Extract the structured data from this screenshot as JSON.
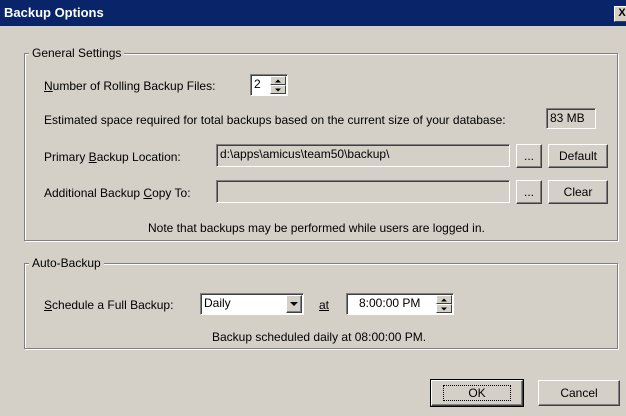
{
  "window": {
    "title": "Backup Options",
    "close_label": "X"
  },
  "general": {
    "legend": "General Settings",
    "rolling": {
      "label_pre": "",
      "label_accel": "N",
      "label_post": "umber of Rolling Backup Files:",
      "value": "2"
    },
    "estimate": {
      "label": "Estimated space required for total backups based on the current size of your database:",
      "value": "83 MB"
    },
    "primary": {
      "label_pre": "Primary ",
      "label_accel": "B",
      "label_post": "ackup Location:",
      "value": "d:\\apps\\amicus\\team50\\backup\\",
      "browse_label": "...",
      "default_label": "Default"
    },
    "additional": {
      "label_pre": "Additional Backup ",
      "label_accel": "C",
      "label_post": "opy To:",
      "value": "",
      "browse_label": "...",
      "clear_label": "Clear"
    },
    "note": "Note that backups may be performed while users are logged in."
  },
  "autobackup": {
    "legend": "Auto-Backup",
    "schedule": {
      "label_pre": "",
      "label_accel": "S",
      "label_post": "chedule a Full Backup:",
      "selected": "Daily"
    },
    "at_label": "at",
    "time_value": "8:00:00 PM",
    "status": "Backup scheduled daily at 08:00:00 PM."
  },
  "footer": {
    "ok_label": "OK",
    "cancel_label": "Cancel"
  }
}
